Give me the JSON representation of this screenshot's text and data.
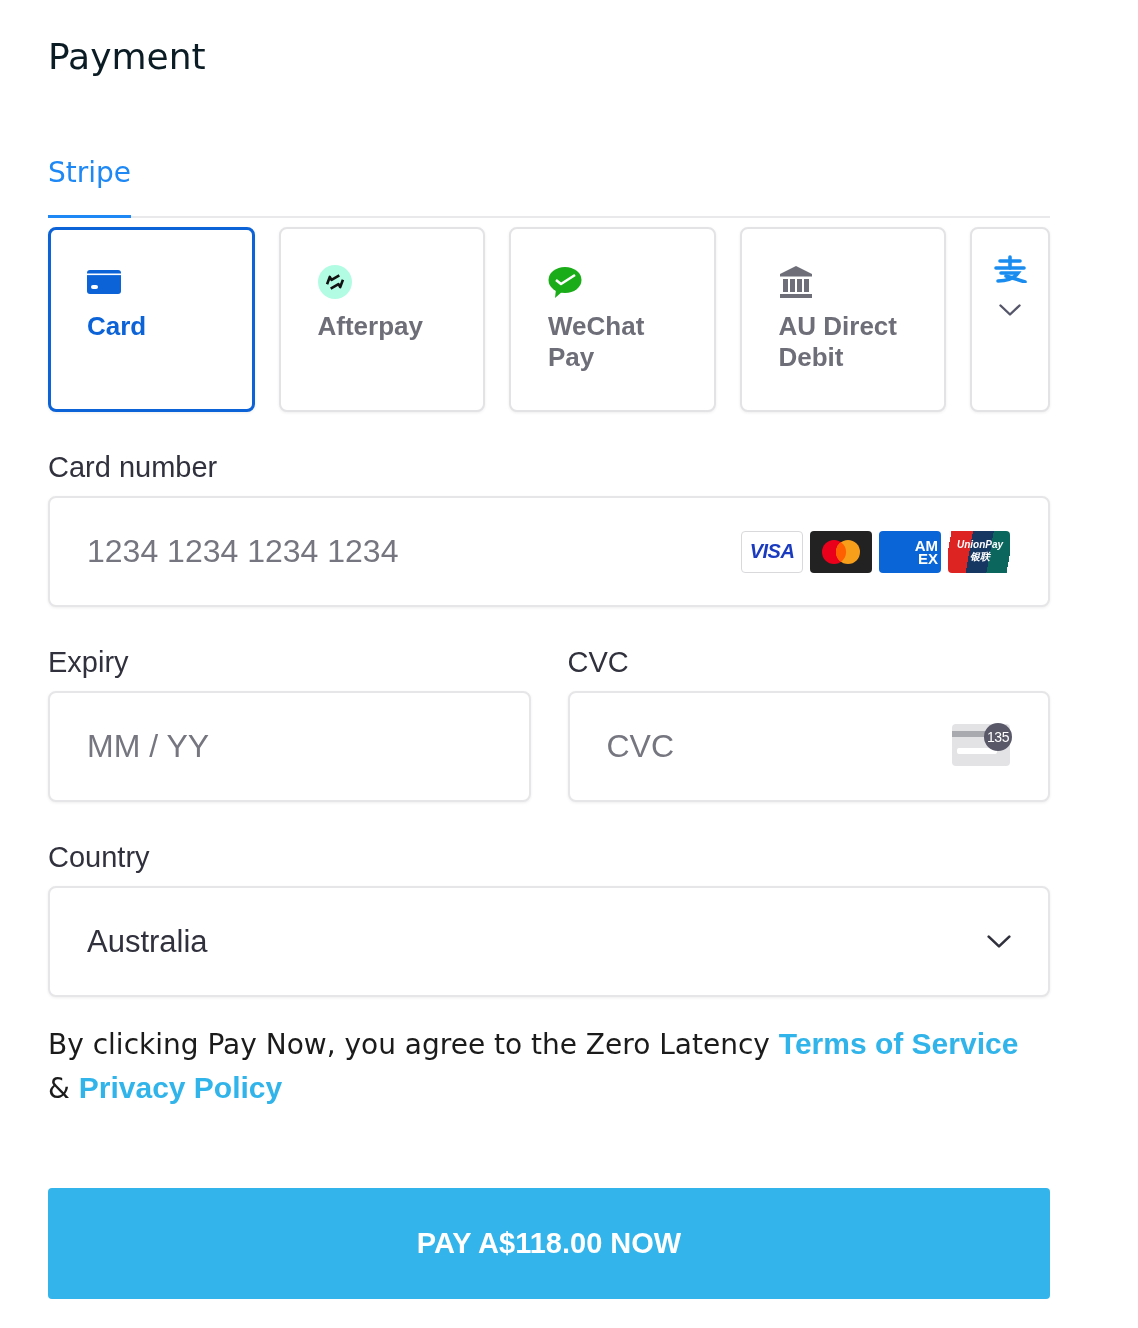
{
  "title": "Payment",
  "tabs": [
    {
      "label": "Stripe",
      "selected": true
    }
  ],
  "methods": [
    {
      "kind": "card",
      "label": "Card",
      "selected": true
    },
    {
      "kind": "afterpay",
      "label": "Afterpay",
      "selected": false
    },
    {
      "kind": "wechat",
      "label": "WeChat Pay",
      "selected": false
    },
    {
      "kind": "bank",
      "label": "AU Direct Debit",
      "selected": false
    },
    {
      "kind": "more",
      "selected": false
    }
  ],
  "card_number": {
    "label": "Card number",
    "placeholder": "1234 1234 1234 1234",
    "brands": [
      {
        "kind": "visa",
        "text": "VISA"
      },
      {
        "kind": "mastercard"
      },
      {
        "kind": "amex",
        "text": "AM EX"
      },
      {
        "kind": "unionpay",
        "text": "UnionPay 银联"
      }
    ]
  },
  "expiry": {
    "label": "Expiry",
    "placeholder": "MM / YY"
  },
  "cvc": {
    "label": "CVC",
    "placeholder": "CVC",
    "hint": "135"
  },
  "country": {
    "label": "Country",
    "value": "Australia"
  },
  "terms": [
    {
      "kind": "text",
      "text": "By clicking Pay Now, you agree to the Zero Latency"
    },
    {
      "kind": "link",
      "text": "Terms of Service"
    },
    {
      "kind": "text",
      "text": "&"
    },
    {
      "kind": "link",
      "text": "Privacy Policy"
    }
  ],
  "pay_button": {
    "label": "PAY A$118.00 NOW"
  }
}
